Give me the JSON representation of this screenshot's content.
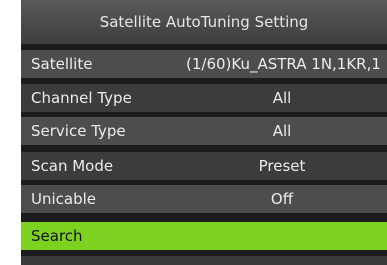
{
  "title": "Satellite AutoTuning Setting",
  "rows": [
    {
      "label": "Satellite",
      "value": "(1/60)Ku_ASTRA 1N,1KR,1"
    },
    {
      "label": "Channel Type",
      "value": "All"
    },
    {
      "label": "Service Type",
      "value": "All"
    },
    {
      "label": "Scan Mode",
      "value": "Preset"
    },
    {
      "label": "Unicable",
      "value": "Off"
    },
    {
      "label": "Search",
      "value": ""
    }
  ],
  "colors": {
    "selected_row": "#7cd21e",
    "row_light": "#4d4d4d",
    "row_dark": "#3c3c3c",
    "background": "#1c1c1c"
  }
}
